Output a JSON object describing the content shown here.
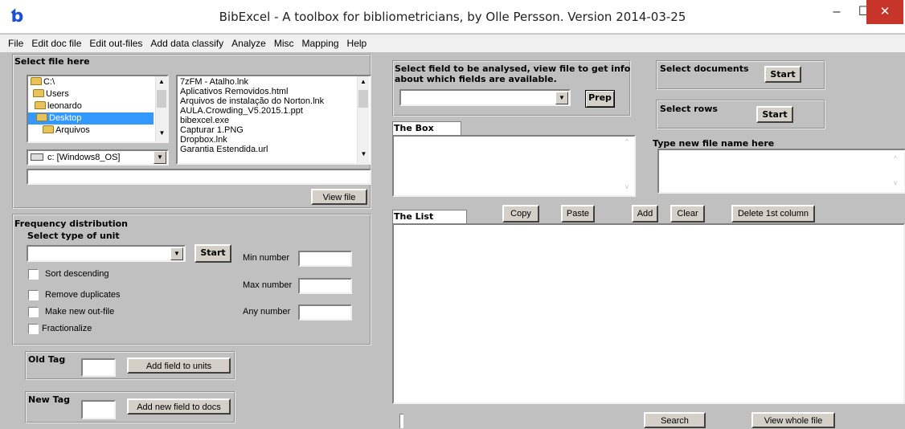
{
  "window": {
    "title": "BibExcel - A toolbox for bibliometricians, by Olle Persson. Version 2014-03-25",
    "min_glyph": "–",
    "max_glyph": "☐",
    "close_glyph": "✕",
    "app_icon_glyph": "ƅ"
  },
  "menu": [
    "File",
    "Edit doc file",
    "Edit out-files",
    "Add data classify",
    "Analyze",
    "Misc",
    "Mapping",
    "Help"
  ],
  "select_file": {
    "title": "Select file here",
    "tree": [
      "C:\\",
      "Users",
      "leonardo",
      "Desktop",
      "Arquivos"
    ],
    "selected_tree_item": "Desktop",
    "files": [
      "7zFM - Atalho.lnk",
      "Aplicativos Removidos.html",
      "Arquivos de instalação do Norton.lnk",
      "AULA.Crowding_V5.2015.1.ppt",
      "bibexcel.exe",
      "Capturar 1.PNG",
      "Dropbox.lnk",
      "Garantia Estendida.url"
    ],
    "drive": "c: [Windows8_OS]",
    "path_value": "",
    "view_file_label": "View file"
  },
  "field_select": {
    "title_line1": "Select field to be analysed, view file to get info",
    "title_line2": "about which fields are available.",
    "field_value": "",
    "prep_label": "Prep"
  },
  "select_documents": {
    "title": "Select documents",
    "start_label": "Start"
  },
  "select_rows": {
    "title": "Select rows",
    "start_label": "Start"
  },
  "the_box": {
    "title": "The Box",
    "value": ""
  },
  "new_file_name": {
    "title": "Type new file name here",
    "value": ""
  },
  "the_list": {
    "title": "The List",
    "copy_label": "Copy",
    "paste_label": "Paste",
    "add_label": "Add",
    "clear_label": "Clear",
    "delete_label": "Delete 1st column",
    "search_label": "Search",
    "view_whole_label": "View whole file"
  },
  "frequency": {
    "title": "Frequency distribution",
    "unit_label": "Select type of unit",
    "unit_value": "",
    "start_label": "Start",
    "checks": [
      {
        "label": "Sort descending",
        "checked": false
      },
      {
        "label": "Remove duplicates",
        "checked": false
      },
      {
        "label": "Make new out-file",
        "checked": false
      },
      {
        "label": "Fractionalize",
        "checked": false
      }
    ],
    "min_label": "Min number",
    "max_label": "Max number",
    "any_label": "Any number",
    "min_value": "",
    "max_value": "",
    "any_value": ""
  },
  "old_tag": {
    "label": "Old Tag",
    "value": "",
    "button": "Add field to units"
  },
  "new_tag": {
    "label": "New Tag",
    "value": "",
    "button": "Add new field to docs"
  }
}
